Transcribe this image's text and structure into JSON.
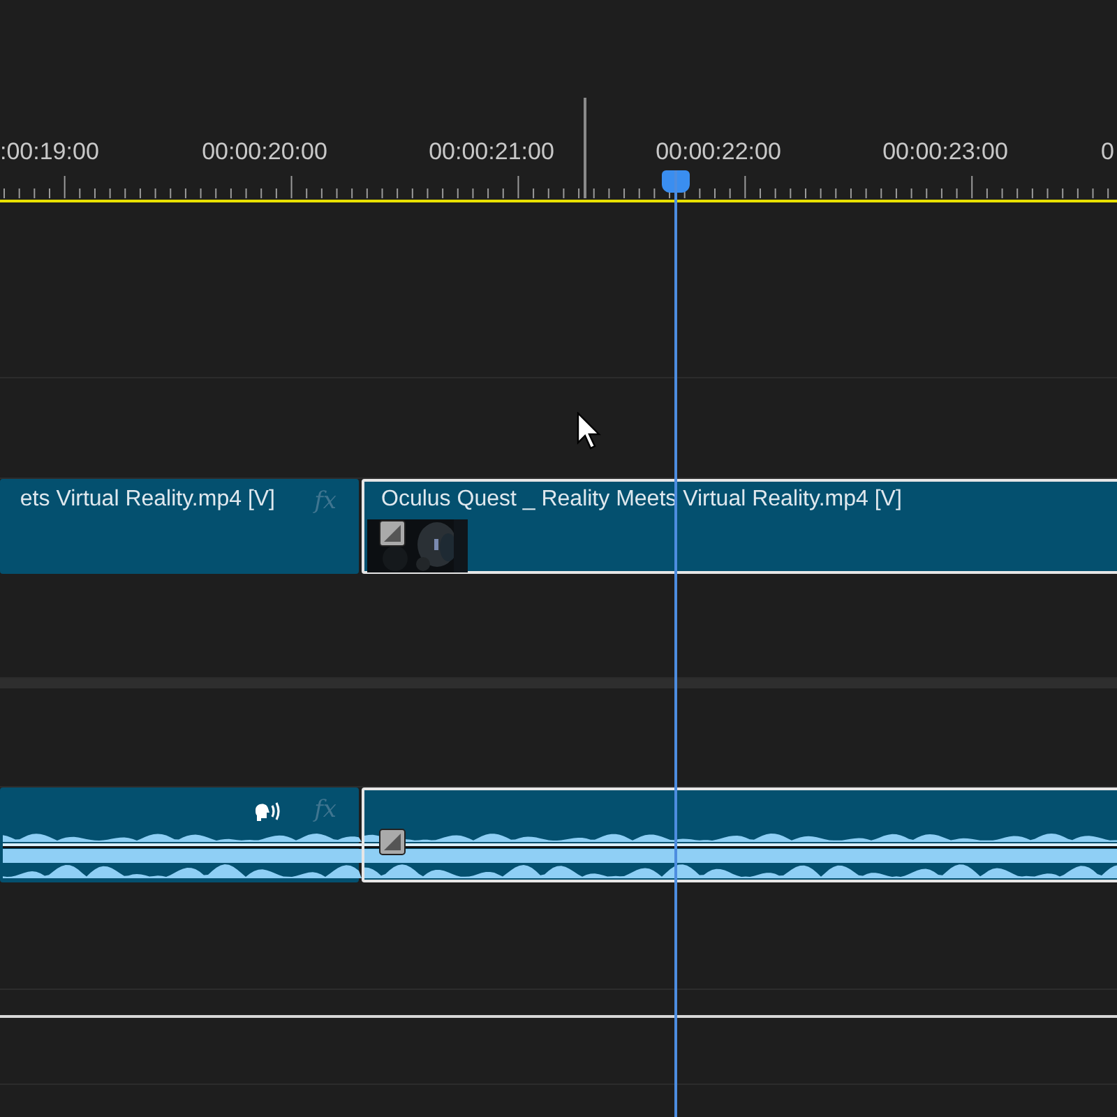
{
  "ruler": {
    "labels": [
      ":00:19:00",
      "00:00:20:00",
      "00:00:21:00",
      "00:00:22:00",
      "00:00:23:00",
      "0"
    ]
  },
  "video_track": {
    "clips": [
      {
        "name": "ets Virtual Reality.mp4 [V]",
        "selected": false,
        "fx": "fx",
        "thumbnail": false
      },
      {
        "name": "Oculus Quest _ Reality Meets Virtual Reality.mp4 [V]",
        "selected": true,
        "thumbnail": true
      }
    ]
  },
  "audio_track": {
    "clips": [
      {
        "selected": false,
        "fx": "fx",
        "voice": true
      },
      {
        "selected": true,
        "voice": false
      }
    ]
  }
}
